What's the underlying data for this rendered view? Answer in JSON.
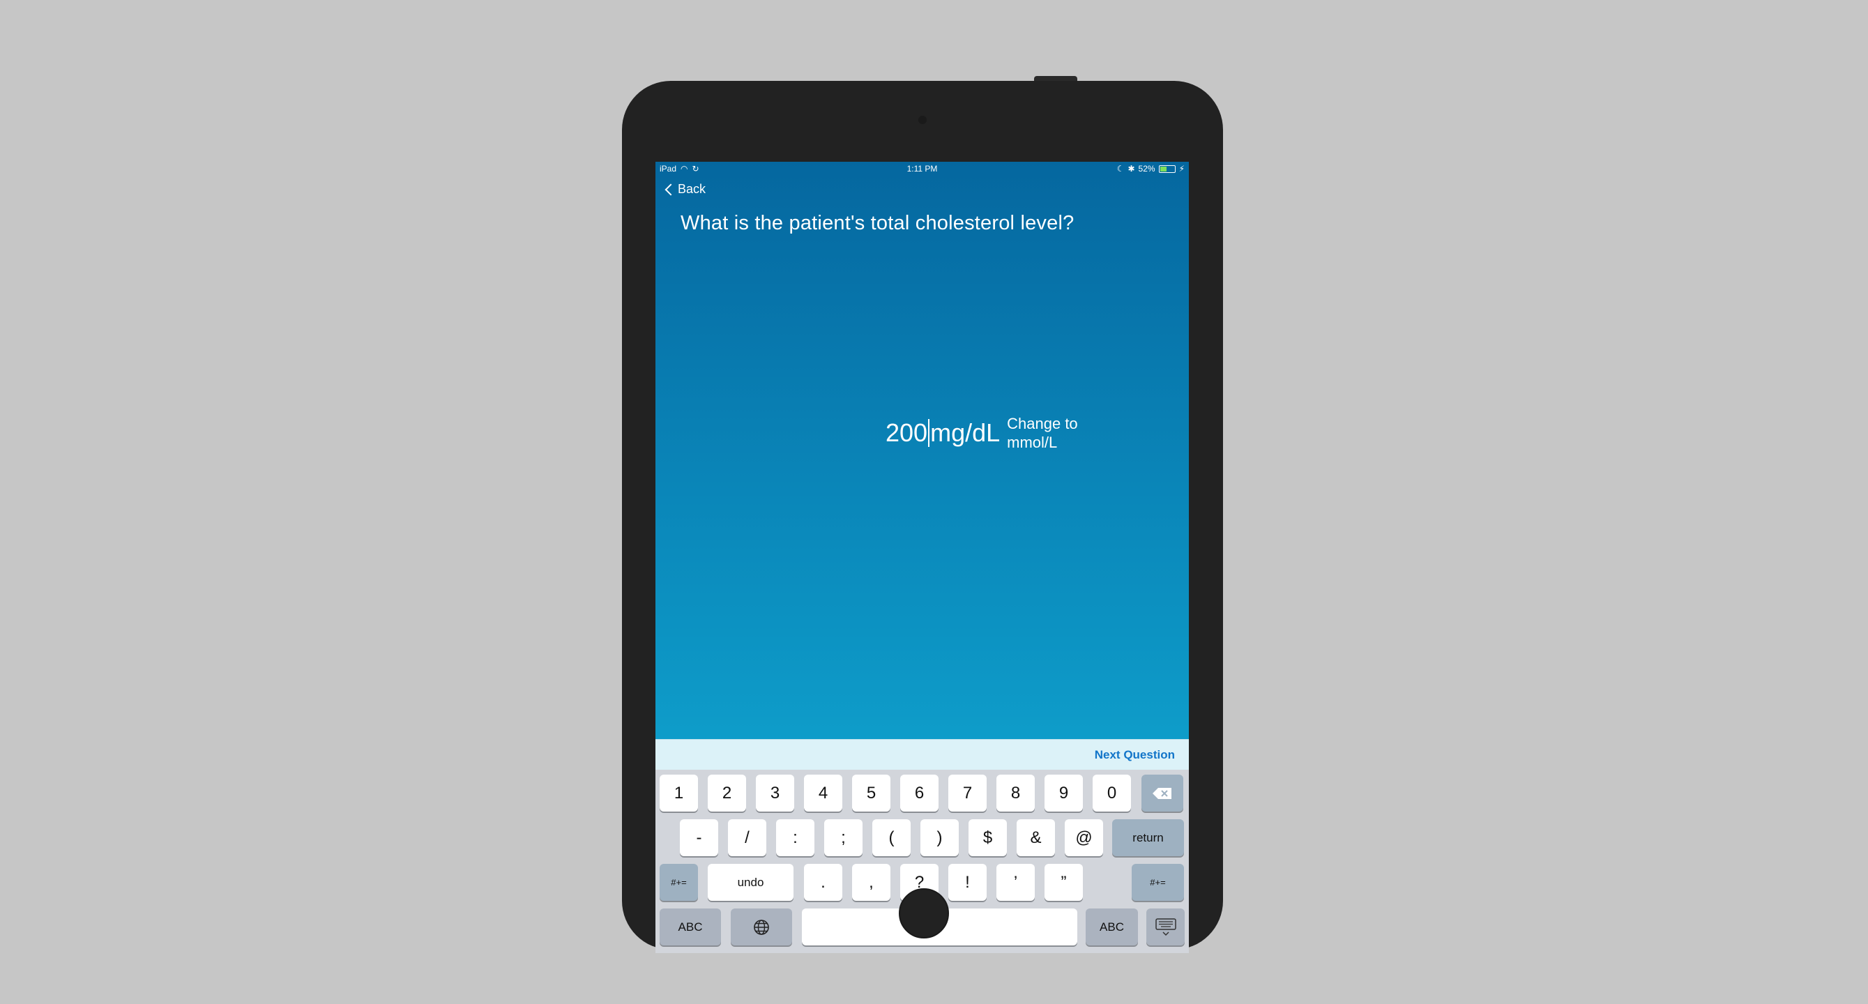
{
  "status_bar": {
    "device": "iPad",
    "time": "1:11 PM",
    "battery": "52%",
    "battery_level": 0.52
  },
  "nav": {
    "back_label": "Back"
  },
  "question": {
    "text": "What is the patient's total cholesterol level?",
    "value": "200",
    "unit": "mg/dL",
    "change_unit_label": "Change to mmol/L"
  },
  "next_question_label": "Next Question",
  "keyboard": {
    "row1": [
      "1",
      "2",
      "3",
      "4",
      "5",
      "6",
      "7",
      "8",
      "9",
      "0"
    ],
    "row2": [
      "-",
      "/",
      ":",
      ";",
      "(",
      ")",
      "$",
      "&",
      "@"
    ],
    "return_label": "return",
    "symbols_label": "#+=",
    "undo_label": "undo",
    "row3": [
      ".",
      ",",
      "?",
      "!",
      "’",
      "”"
    ],
    "abc_label": "ABC"
  },
  "colors": {
    "background": "#c6c6c6",
    "screen_top": "#05679f",
    "screen_bottom": "#11b0d8",
    "accent": "#1275c9"
  }
}
